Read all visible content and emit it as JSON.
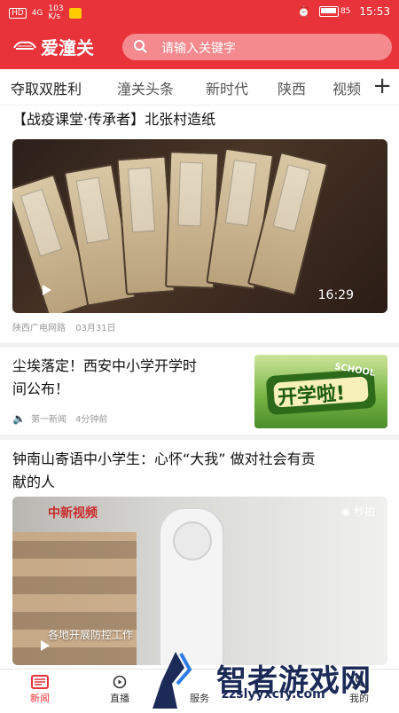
{
  "status": {
    "left": [
      "HD",
      "4G",
      "103",
      "K/s"
    ],
    "time": "15:53",
    "battery": "85"
  },
  "header": {
    "app_name": "爱潼关",
    "search_placeholder": "请输入关键字"
  },
  "tabs": [
    {
      "label": "夺取双胜利",
      "active": true
    },
    {
      "label": "潼关头条",
      "active": false
    },
    {
      "label": "新时代",
      "active": false
    },
    {
      "label": "陕西",
      "active": false
    },
    {
      "label": "视频",
      "active": false
    }
  ],
  "feed": {
    "item1": {
      "title": "【战疫课堂·传承者】北张村造纸",
      "duration": "16:29",
      "source": "陕西广电网路",
      "date": "03月31日"
    },
    "item2": {
      "title_line1": "尘埃落定！西安中小学开学时",
      "title_line2": "间公布！",
      "source": "第一新闻",
      "time": "4分钟前",
      "thumb_text_main": "开学啦!",
      "thumb_text_small": "SCHOOL"
    },
    "item3": {
      "title_line1": "钟南山寄语中小学生：心怀“大我” 做对社会有贡",
      "title_line2": "献的人",
      "video_watermark_left": "中新视频",
      "video_watermark_right": "秒拍",
      "caption": "各地开展防控工作"
    }
  },
  "bottom_nav": [
    {
      "label": "新闻",
      "active": true
    },
    {
      "label": "直播",
      "active": false
    },
    {
      "label": "服务",
      "active": false
    },
    {
      "label": "我的",
      "active": false
    }
  ],
  "overlay": {
    "brand": "智者游戏网",
    "url": "zzslyyxcfy.com"
  },
  "colors": {
    "brand_red": "#e8333a"
  }
}
